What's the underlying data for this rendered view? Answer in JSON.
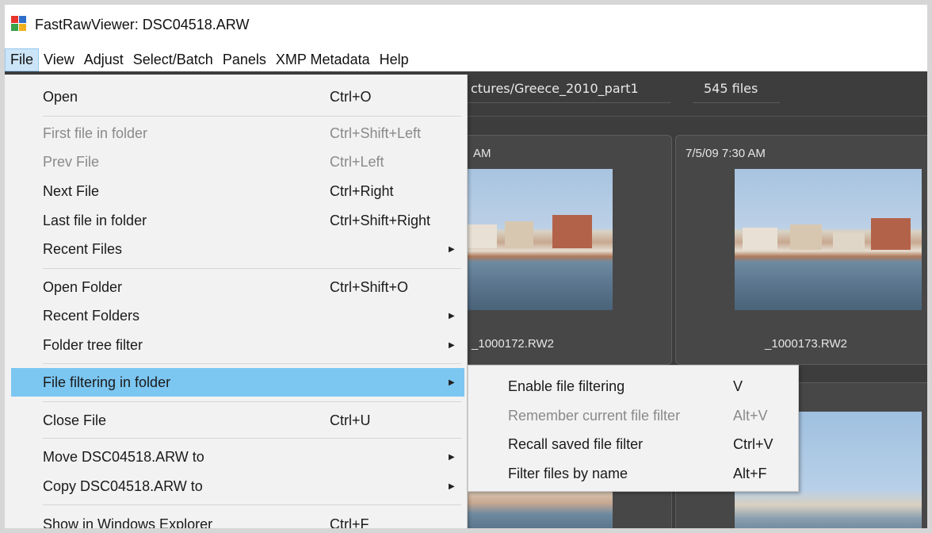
{
  "window": {
    "title": "FastRawViewer: DSC04518.ARW",
    "icon": "fastrawviewer-logo-icon",
    "icon_colors": [
      "#e8352b",
      "#2f6fc9",
      "#3aa34a",
      "#f2b01e"
    ]
  },
  "menubar": {
    "items": [
      {
        "label": "File",
        "active": true
      },
      {
        "label": "View"
      },
      {
        "label": "Adjust"
      },
      {
        "label": "Select/Batch"
      },
      {
        "label": "Panels"
      },
      {
        "label": "XMP Metadata"
      },
      {
        "label": "Help"
      }
    ]
  },
  "toolbar": {
    "path_text": "ctures/Greece_2010_part1",
    "file_count": "545 files"
  },
  "thumbnails": [
    {
      "date": "AM",
      "filename": "_1000172.RW2"
    },
    {
      "date": "7/5/09 7:30 AM",
      "filename": "_1000173.RW2"
    }
  ],
  "file_menu": {
    "items": [
      {
        "label": "Open",
        "shortcut": "Ctrl+O"
      },
      {
        "label": "First file in folder",
        "shortcut": "Ctrl+Shift+Left",
        "disabled": true
      },
      {
        "label": "Prev File",
        "shortcut": "Ctrl+Left",
        "disabled": true
      },
      {
        "label": "Next File",
        "shortcut": "Ctrl+Right"
      },
      {
        "label": "Last file in folder",
        "shortcut": "Ctrl+Shift+Right"
      },
      {
        "label": "Recent Files",
        "submenu": true
      },
      {
        "label": "Open Folder",
        "shortcut": "Ctrl+Shift+O"
      },
      {
        "label": "Recent Folders",
        "submenu": true
      },
      {
        "label": "Folder tree filter",
        "submenu": true
      },
      {
        "label": "File filtering in folder",
        "submenu": true,
        "highlighted": true
      },
      {
        "label": "Close File",
        "shortcut": "Ctrl+U"
      },
      {
        "label": "Move DSC04518.ARW to",
        "submenu": true
      },
      {
        "label": "Copy DSC04518.ARW to",
        "submenu": true
      },
      {
        "label": "Show in Windows Explorer",
        "shortcut": "Ctrl+F"
      }
    ]
  },
  "sub_menu": {
    "items": [
      {
        "label": "Enable file filtering",
        "shortcut": "V"
      },
      {
        "label": "Remember current file filter",
        "shortcut": "Alt+V",
        "disabled": true
      },
      {
        "label": "Recall saved file filter",
        "shortcut": "Ctrl+V"
      },
      {
        "label": "Filter files by name",
        "shortcut": "Alt+F"
      }
    ]
  },
  "colors": {
    "menu_highlight": "#7cc6f2",
    "app_background": "#3d3d3d",
    "menu_background": "#f2f2f2"
  }
}
